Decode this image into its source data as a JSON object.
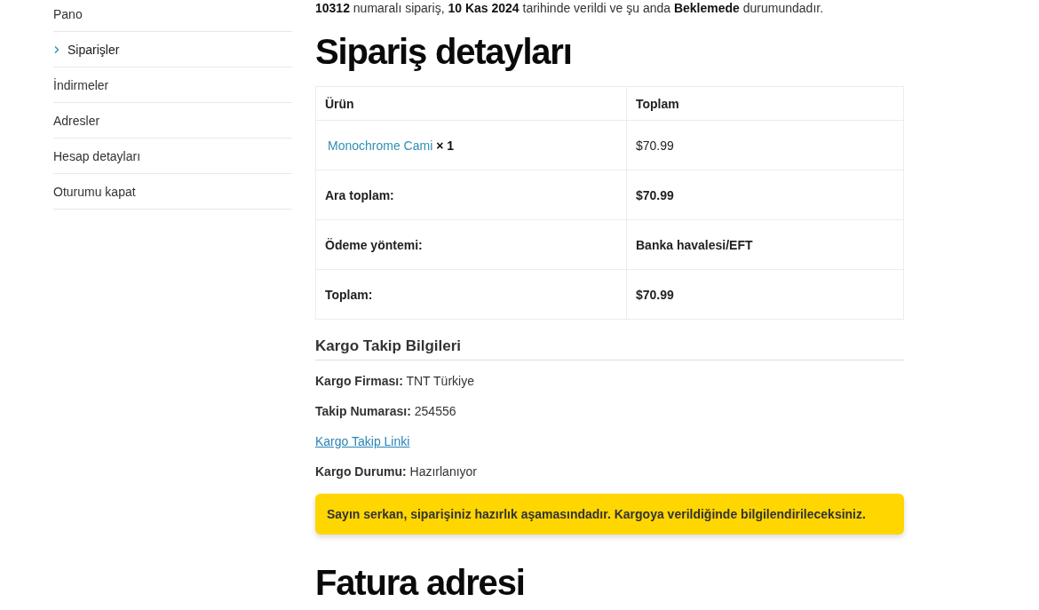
{
  "sidebar": {
    "items": [
      {
        "label": "Pano",
        "selected": false
      },
      {
        "label": "Siparişler",
        "selected": true
      },
      {
        "label": "İndirmeler",
        "selected": false
      },
      {
        "label": "Adresler",
        "selected": false
      },
      {
        "label": "Hesap detayları",
        "selected": false
      },
      {
        "label": "Oturumu kapat",
        "selected": false
      }
    ]
  },
  "order_summary": "**10312** numaralı sipariş, **10 Kas 2024** tarihinde verildi ve şu anda **Beklemede** durumundadır.",
  "order_details": {
    "title": "Sipariş detayları",
    "table": {
      "columns": [
        "Ürün",
        "Toplam"
      ],
      "rows": [
        {
          "product": "Monochrome Cami",
          "quantity": "× 1",
          "total": "$70.99"
        }
      ],
      "totals": [
        {
          "label": "Ara toplam:",
          "value": "$70.99"
        },
        {
          "label": "Ödeme yöntemi:",
          "value": "Banka havalesi/EFT"
        },
        {
          "label": "Toplam:",
          "value": "$70.99"
        }
      ]
    }
  },
  "shipping": {
    "title": "Kargo Takip Bilgileri",
    "fields": [
      {
        "kind": "text",
        "label": "Kargo Firması:",
        "value": "TNT Türkiye"
      },
      {
        "kind": "text",
        "label": "Takip Numarası:",
        "value": "254556"
      },
      {
        "kind": "link",
        "value": "Kargo Takip Linki"
      },
      {
        "kind": "text",
        "label": "Kargo Durumu:",
        "value": "Hazırlanıyor"
      }
    ],
    "notice": "Sayın serkan, siparişiniz hazırlık aşamasındadır. Kargoya verildiğinde bilgilendirileceksiniz."
  },
  "billing": {
    "title": "Fatura adresi"
  }
}
